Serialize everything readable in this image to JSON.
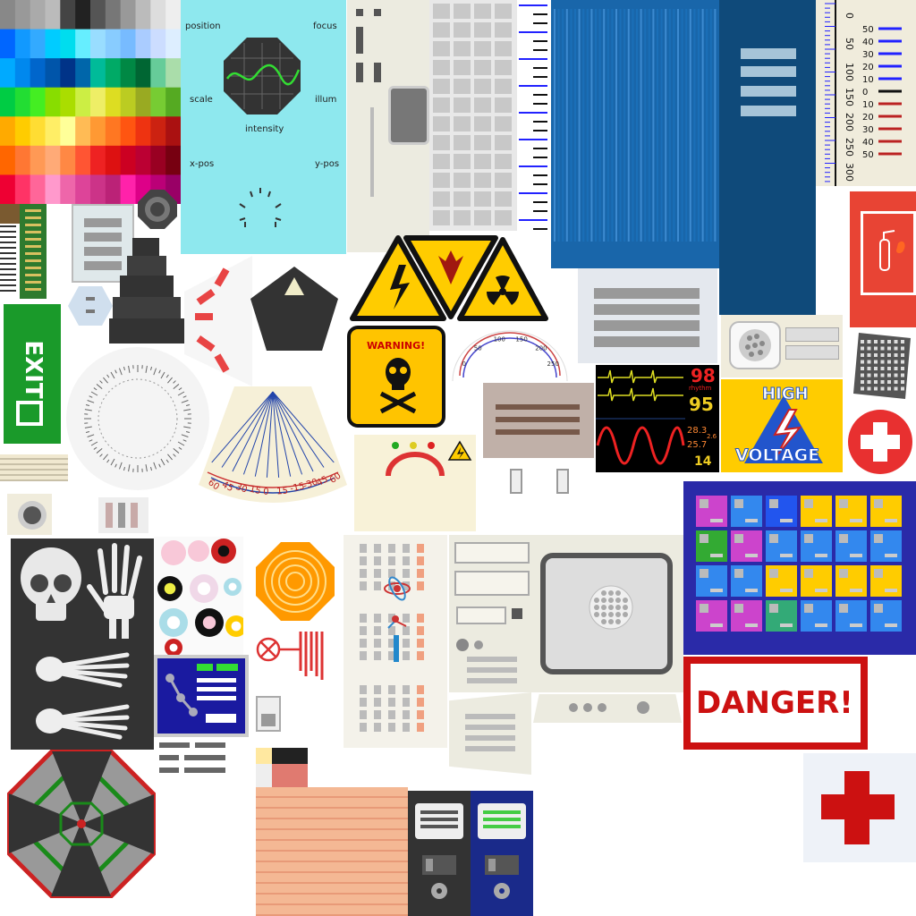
{
  "scope_panel": {
    "labels": [
      "position",
      "focus",
      "scale",
      "illum",
      "intensity",
      "x-pos",
      "y-pos"
    ]
  },
  "ruler_tall": {
    "ticks": [
      "0",
      "50",
      "100",
      "150",
      "200",
      "250",
      "300"
    ],
    "right_ticks": [
      "50",
      "40",
      "30",
      "20",
      "10",
      "0",
      "10",
      "20",
      "30",
      "40",
      "50"
    ]
  },
  "hazard": {
    "warning_label": "WARNING!"
  },
  "arc_gauge": {
    "ticks": [
      "0",
      "50",
      "100",
      "150",
      "200",
      "250"
    ]
  },
  "monitor": {
    "readouts": [
      "98",
      "rhythm",
      "95",
      "28.3",
      "25.7",
      "2.6",
      "14"
    ]
  },
  "high_voltage": {
    "line1": "HIGH",
    "line2": "VOLTAGE"
  },
  "fan_gauge": {
    "ticks": [
      "60",
      "45",
      "30",
      "15",
      "0",
      "15",
      "-15",
      "-30",
      "45",
      "60"
    ]
  },
  "exit_sign": {
    "label": "EXIT"
  },
  "danger_sign": {
    "label": "DANGER!"
  },
  "colors": {
    "hazard_yellow": "#ffcc00",
    "danger_red": "#cc1111",
    "exit_green": "#1a9a2a",
    "scope_bg": "#8ee8ee",
    "blue_panel": "#1763a6"
  }
}
